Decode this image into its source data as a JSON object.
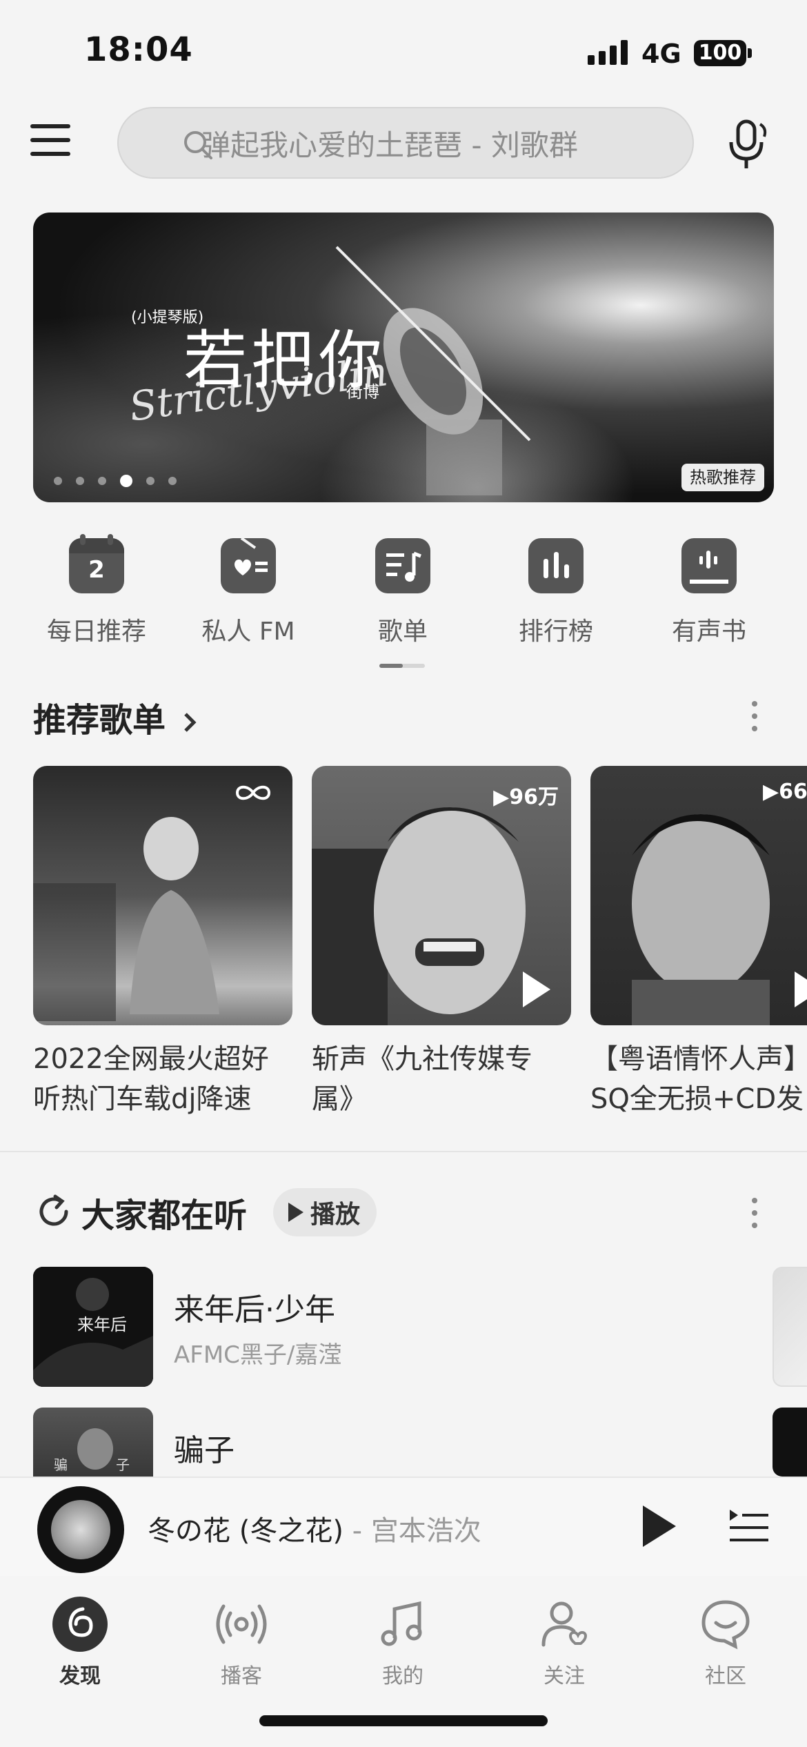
{
  "status_bar": {
    "time": "18:04",
    "network": "4G",
    "battery": "100"
  },
  "search": {
    "placeholder": "弹起我心爱的土琵琶 - 刘歌群"
  },
  "banner": {
    "subtitle": "(小提琴版)",
    "title": "若把你",
    "script_text": "Strictlyviolin",
    "artist": "街博",
    "tag": "热歌推荐",
    "slide_count": 6,
    "active_slide": 4
  },
  "quick_nav": [
    {
      "label": "每日推荐",
      "icon": "calendar-icon",
      "day": "2"
    },
    {
      "label": "私人 FM",
      "icon": "radio-icon"
    },
    {
      "label": "歌单",
      "icon": "playlist-icon"
    },
    {
      "label": "排行榜",
      "icon": "chart-icon"
    },
    {
      "label": "有声书",
      "icon": "audiobook-icon"
    }
  ],
  "recommended": {
    "title": "推荐歌单",
    "playlists": [
      {
        "title_line1": "2022全网最火超好",
        "title_line2": "听热门车载dj降速",
        "count": ""
      },
      {
        "title_line1": "斩声《九社传媒专",
        "title_line2": "属》",
        "count": "96万"
      },
      {
        "title_line1": "【粤语情怀人声】",
        "title_line2": "SQ全无损+CD发",
        "count": "66"
      }
    ]
  },
  "everyone": {
    "title": "大家都在听",
    "play_label": "播放",
    "songs": [
      {
        "name": "来年后·少年",
        "artist": "AFMC黑子/嘉滢"
      },
      {
        "name": "骗子",
        "artist": ""
      }
    ]
  },
  "mini_player": {
    "song": "冬の花 (冬之花)",
    "separator": "-",
    "artist": "宫本浩次"
  },
  "tabs": [
    {
      "label": "发现",
      "icon": "discover-icon",
      "active": true
    },
    {
      "label": "播客",
      "icon": "podcast-icon",
      "active": false
    },
    {
      "label": "我的",
      "icon": "music-note-icon",
      "active": false
    },
    {
      "label": "关注",
      "icon": "follow-icon",
      "active": false
    },
    {
      "label": "社区",
      "icon": "community-icon",
      "active": false
    }
  ]
}
